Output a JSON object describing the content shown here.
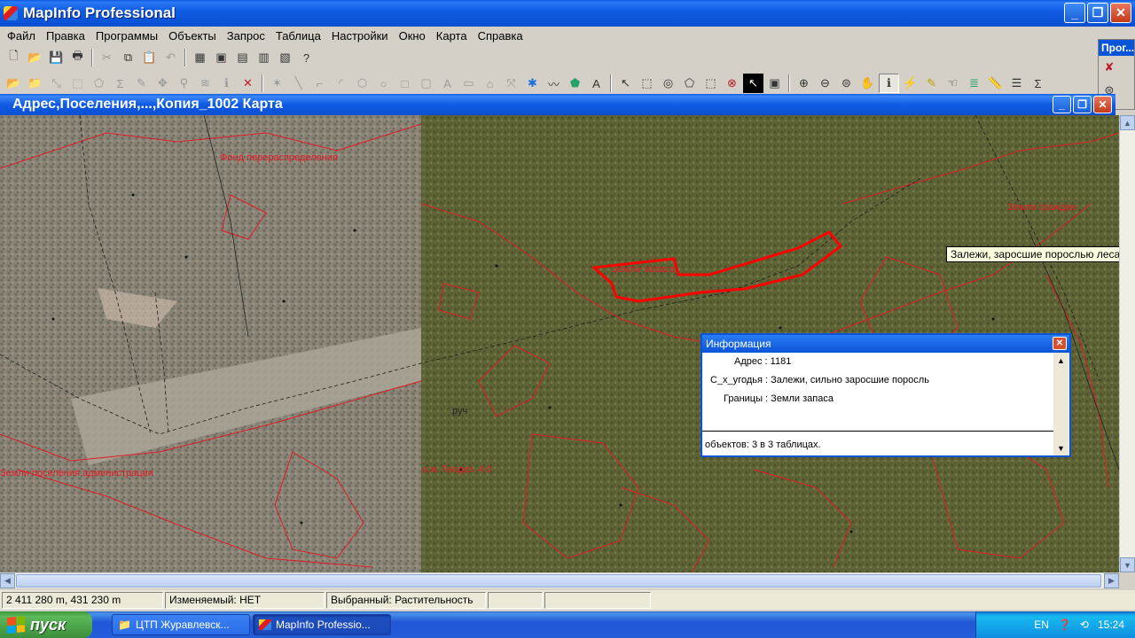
{
  "app": {
    "title": "MapInfo Professional"
  },
  "menu": [
    "Файл",
    "Правка",
    "Программы",
    "Объекты",
    "Запрос",
    "Таблица",
    "Настройки",
    "Окно",
    "Карта",
    "Справка"
  ],
  "side_panel": {
    "title": "Прог..."
  },
  "map_window": {
    "title": "Адрес,Поселения,...,Копия_1002 Карта"
  },
  "map_labels": {
    "top_left": "Фонд перераспределения",
    "bottom_left": "Земли поселения администрации",
    "mid": "о.м. Геодез. 4.0",
    "reserve": "Земли запаса",
    "citizens": "Земли граждан",
    "stream": "руч"
  },
  "tooltip": "Залежи, заросшие порослью леса",
  "info_window": {
    "title": "Информация",
    "rows": [
      {
        "label": "Адрес",
        "value": "1181"
      },
      {
        "label": "С_х_угодья",
        "value": "Залежи, сильно заросшие поросль"
      },
      {
        "label": "Границы",
        "value": "Земли запаса"
      }
    ],
    "footer": "объектов: 3 в 3 таблицах."
  },
  "status": {
    "coords": "2 411 280 m, 431 230 m",
    "editable": "Изменяемый: НЕТ",
    "selected": "Выбранный: Растительность"
  },
  "taskbar": {
    "start": "пуск",
    "items": [
      "ЦТП Журавлевск...",
      "MapInfo Professio..."
    ],
    "lang": "EN",
    "time": "15:24"
  },
  "colors": {
    "boundary": "#e01b24",
    "selection": "#ff0000",
    "titlebar": "#0a54d8"
  }
}
